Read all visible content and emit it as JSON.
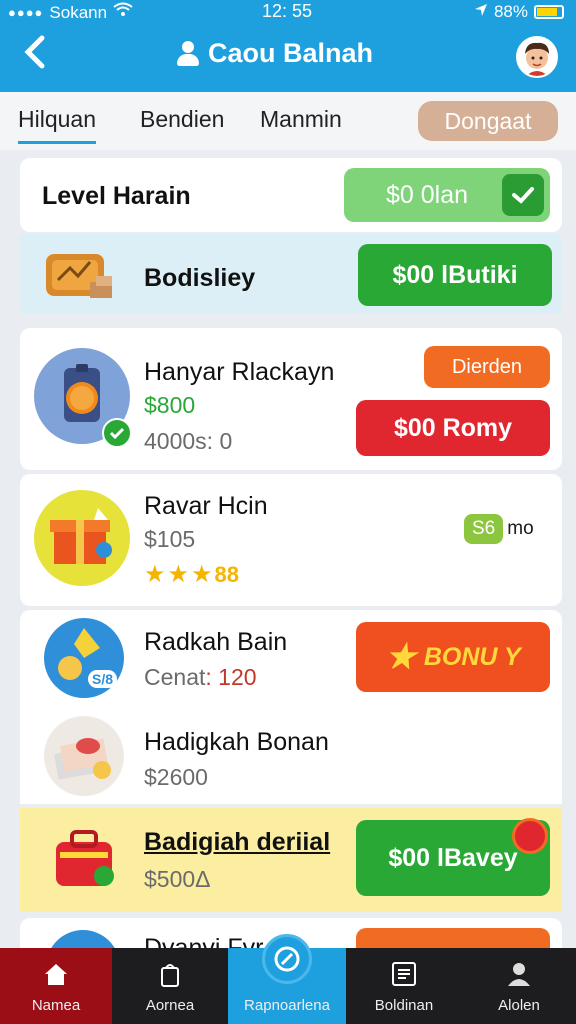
{
  "status": {
    "carrier": "Sokann",
    "time": "12: 55",
    "battery": "88%"
  },
  "header": {
    "title": "Caou Balnah"
  },
  "tabs": [
    {
      "label": "Hilquan"
    },
    {
      "label": "Bendien"
    },
    {
      "label": "Manmin"
    }
  ],
  "tab_pill": "Dongaat",
  "level": {
    "label": "Level Harain",
    "button": "$0 0lan"
  },
  "featured": {
    "label": "Bodisliey",
    "button": "$00 lButiki"
  },
  "items": [
    {
      "name": "Hanyar Rlackayn",
      "price": "$800",
      "sub": "4000s: 0",
      "badge": "Dierden",
      "button": "$00 Romy"
    },
    {
      "name": "Ravar Hcin",
      "price": "$105",
      "stars_suffix": "88",
      "badge": "S6",
      "badge_text": "mo"
    },
    {
      "name": "Radkah Bain",
      "price_prefix": "Cenat",
      "price": "120",
      "icon_text": "S/8",
      "button": "BONU Y"
    },
    {
      "name": "Hadigkah Bonan",
      "price": "$2600"
    },
    {
      "name": "Badigiah deriial",
      "price": "$500Δ",
      "button": "$00 lBavey"
    }
  ],
  "partial_row": {
    "name": "Dvanvi Fvr"
  },
  "nav": [
    {
      "label": "Namea",
      "icon": "home-icon"
    },
    {
      "label": "Aornea",
      "icon": "bag-icon"
    },
    {
      "label": "Rapnoarlena",
      "icon": "edit-icon"
    },
    {
      "label": "Boldinan",
      "icon": "list-icon"
    },
    {
      "label": "Alolen",
      "icon": "user-icon"
    }
  ],
  "colors": {
    "header": "#1ea0df",
    "green": "#2aa836",
    "red": "#e0262f",
    "orange": "#f26b22"
  }
}
